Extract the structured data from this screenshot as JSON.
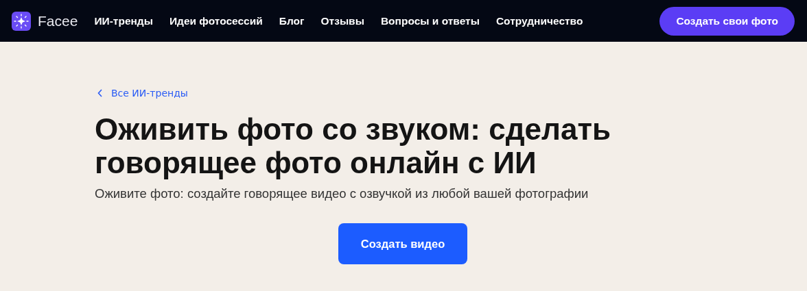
{
  "header": {
    "logo": "Facee",
    "nav": [
      "ИИ-тренды",
      "Идеи фотосессий",
      "Блог",
      "Отзывы",
      "Вопросы и ответы",
      "Сотрудничество"
    ],
    "cta": "Создать свои фото"
  },
  "hero": {
    "back_link": "Все ИИ-тренды",
    "title": "Оживить фото со звуком: сделать говорящее фото онлайн с ИИ",
    "subtitle": "Оживите фото: создайте говорящее видео с озвучкой из любой вашей фотографии",
    "button": "Создать видео"
  }
}
